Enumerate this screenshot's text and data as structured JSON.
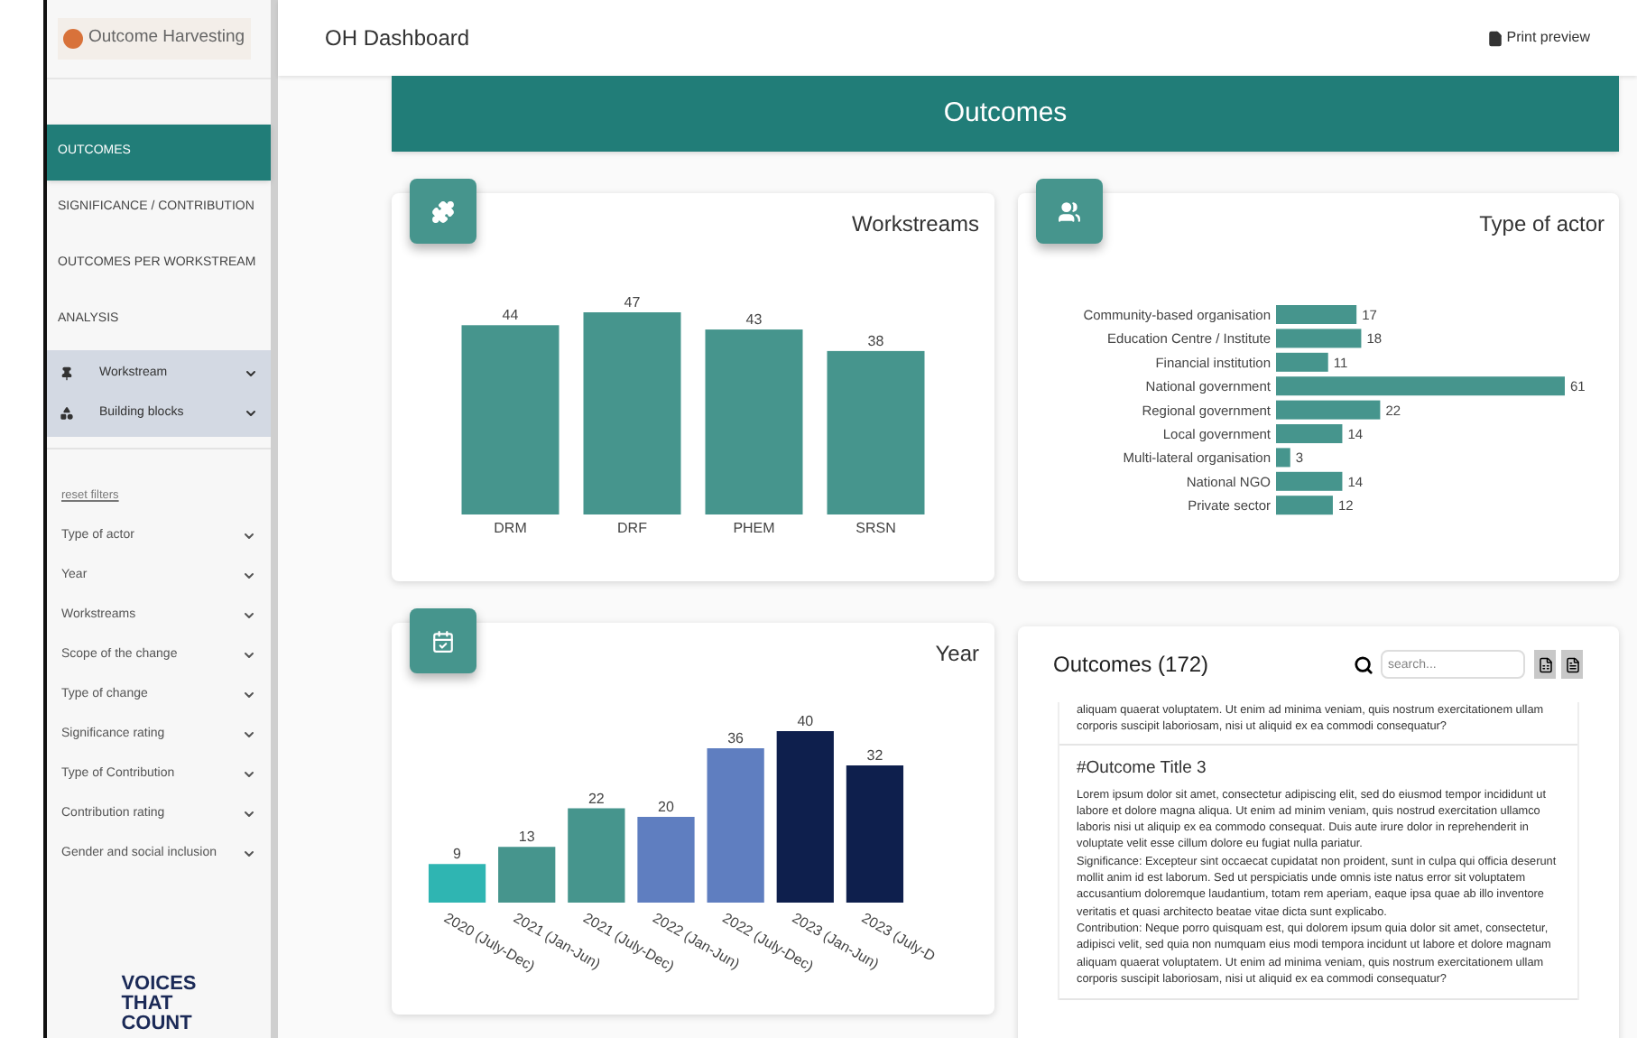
{
  "brand": {
    "name": "Outcome Harvesting"
  },
  "topbar": {
    "title": "OH Dashboard",
    "print": "Print preview"
  },
  "nav": [
    {
      "label": "OUTCOMES",
      "selected": true
    },
    {
      "label": "SIGNIFICANCE / CONTRIBUTION",
      "selected": false
    },
    {
      "label": "OUTCOMES PER WORKSTREAM",
      "selected": false
    },
    {
      "label": "ANALYSIS",
      "selected": false
    }
  ],
  "groups": [
    {
      "label": "Workstream",
      "kind": "pin"
    },
    {
      "label": "Building blocks",
      "kind": "shapes"
    }
  ],
  "reset": "reset filters",
  "filters": [
    "Type of actor",
    "Year",
    "Workstreams",
    "Scope of the change",
    "Type of change",
    "Significance rating",
    "Type of Contribution",
    "Contribution rating",
    "Gender and social inclusion"
  ],
  "logo": [
    "VOICES",
    "THAT",
    "COUNT"
  ],
  "banner": "Outcomes",
  "workstreams": {
    "title": "Workstreams",
    "chart_data": {
      "type": "bar",
      "categories": [
        "DRM",
        "DRF",
        "PHEM",
        "SRSN"
      ],
      "series": [
        {
          "color": "#46958d",
          "values": [
            44,
            47,
            43,
            38
          ]
        }
      ],
      "data_labels": true
    }
  },
  "actors": {
    "title": "Type of actor",
    "chart_data": {
      "type": "bar",
      "orientation": "horizontal",
      "categories": [
        "Community-based organisation",
        "Education Centre / Institute",
        "Financial institution",
        "National government",
        "Regional government",
        "Local government",
        "Multi-lateral organisation",
        "National NGO",
        "Private sector"
      ],
      "series": [
        {
          "color": "#46958d",
          "values": [
            17,
            18,
            11,
            61,
            22,
            14,
            3,
            14,
            12
          ]
        }
      ],
      "data_labels": true
    }
  },
  "year": {
    "title": "Year",
    "chart_data": {
      "type": "bar",
      "categories": [
        "2020 (July-Dec)",
        "2021 (Jan-Jun)",
        "2021 (July-Dec)",
        "2022 (Jan-Jun)",
        "2022 (July-Dec)",
        "2023 (Jan-Jun)",
        "2023 (July-D"
      ],
      "series": [
        {
          "color": "#2fb5b2",
          "values": [
            9,
            null,
            null,
            null,
            null,
            null,
            null
          ]
        },
        {
          "color": "#46958d",
          "values": [
            null,
            13,
            22,
            null,
            null,
            null,
            null
          ]
        },
        {
          "color": "#5f7ec0",
          "values": [
            null,
            null,
            null,
            20,
            36,
            null,
            null
          ]
        },
        {
          "color": "#0e1f4d",
          "values": [
            null,
            null,
            null,
            null,
            null,
            40,
            32
          ]
        }
      ],
      "data_labels": true
    }
  },
  "outcomes": {
    "title": "Outcomes (172)",
    "search_placeholder": "search...",
    "partial": "aliquam quaerat voluptatem. Ut enim ad minima veniam, quis nostrum exercitationem ullam corporis suscipit laboriosam, nisi ut aliquid ex ea commodi consequatur?",
    "items": [
      {
        "title": "#Outcome Title 3",
        "paragraphs": [
          "Lorem ipsum dolor sit amet, consectetur adipiscing elit, sed do eiusmod tempor incididunt ut labore et dolore magna aliqua. Ut enim ad minim veniam, quis nostrud exercitation ullamco laboris nisi ut aliquip ex ea commodo consequat. Duis aute irure dolor in reprehenderit in voluptate velit esse cillum dolore eu fugiat nulla pariatur.",
          "Significance: Excepteur sint occaecat cupidatat non proident, sunt in culpa qui officia deserunt mollit anim id est laborum. Sed ut perspiciatis unde omnis iste natus error sit voluptatem accusantium doloremque laudantium, totam rem aperiam, eaque ipsa quae ab illo inventore veritatis et quasi architecto beatae vitae dicta sunt explicabo.",
          "Contribution: Neque porro quisquam est, qui dolorem ipsum quia dolor sit amet, consectetur, adipisci velit, sed quia non numquam eius modi tempora incidunt ut labore et dolore magnam aliquam quaerat voluptatem. Ut enim ad minima veniam, quis nostrum exercitationem ullam corporis suscipit laboriosam, nisi ut aliquid ex ea commodi consequatur?"
        ]
      }
    ]
  }
}
